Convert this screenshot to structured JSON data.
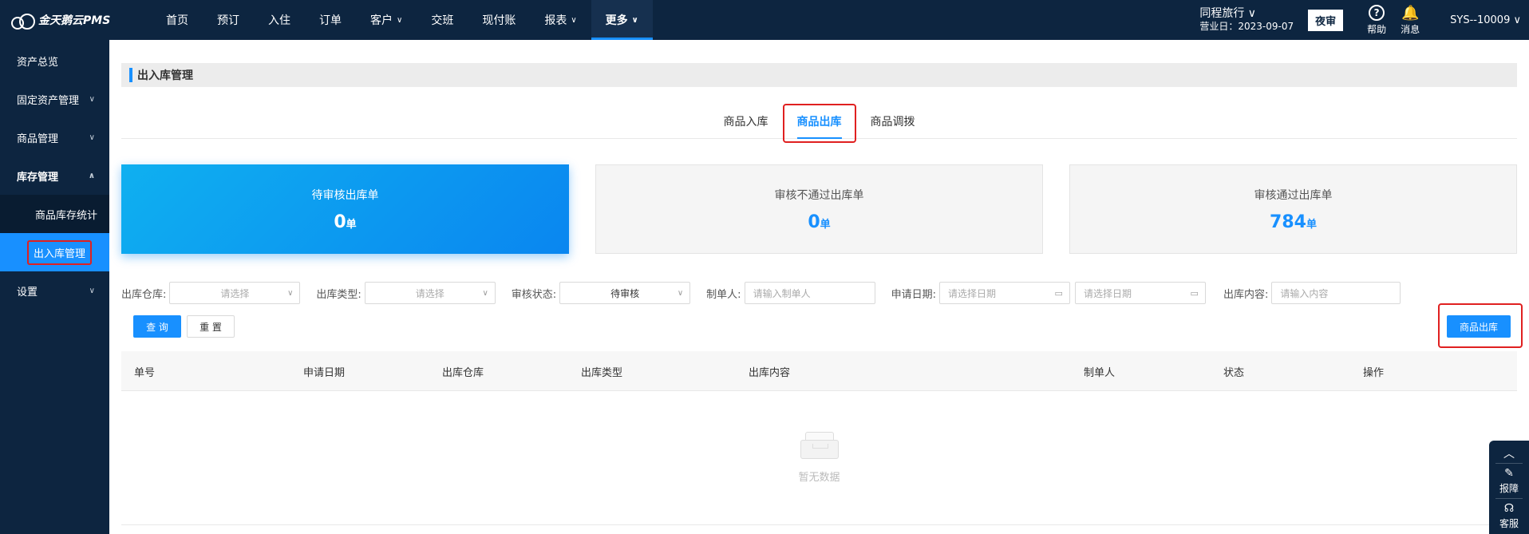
{
  "app": {
    "logo_text": "金天鹅云PMS"
  },
  "nav": [
    {
      "label": "首页",
      "chevron": ""
    },
    {
      "label": "预订",
      "chevron": ""
    },
    {
      "label": "入住",
      "chevron": ""
    },
    {
      "label": "订单",
      "chevron": ""
    },
    {
      "label": "客户",
      "chevron": "∨"
    },
    {
      "label": "交班",
      "chevron": ""
    },
    {
      "label": "现付账",
      "chevron": ""
    },
    {
      "label": "报表",
      "chevron": "∨"
    },
    {
      "label": "更多",
      "chevron": "∨"
    }
  ],
  "topright": {
    "hotel_name": "同程旅行 ∨",
    "business_date": "营业日：2023-09-07",
    "night_audit": "夜审",
    "help_icon": "?",
    "help": "帮助",
    "messages_icon": "🔔",
    "messages": "消息",
    "user": "SYS--10009 ∨"
  },
  "sidebar": {
    "items": [
      {
        "label": "资产总览",
        "arrow": ""
      },
      {
        "label": "固定资产管理",
        "arrow": "∨"
      },
      {
        "label": "商品管理",
        "arrow": "∨"
      },
      {
        "label": "库存管理",
        "arrow": "∧"
      }
    ],
    "subitems": [
      {
        "label": "商品库存统计"
      },
      {
        "label": "出入库管理"
      }
    ],
    "settings": {
      "label": "设置",
      "arrow": "∨"
    }
  },
  "page": {
    "title": "出入库管理",
    "tabs": [
      "商品入库",
      "商品出库",
      "商品调拨"
    ]
  },
  "cards": [
    {
      "title": "待审核出库单",
      "value": "0",
      "unit": "单"
    },
    {
      "title": "审核不通过出库单",
      "value": "0",
      "unit": "单"
    },
    {
      "title": "审核通过出库单",
      "value": "784",
      "unit": "单"
    }
  ],
  "filters": {
    "warehouse_label": "出库仓库:",
    "warehouse_placeholder": "请选择",
    "type_label": "出库类型:",
    "type_placeholder": "请选择",
    "status_label": "审核状态:",
    "status_value": "待审核",
    "creator_label": "制单人:",
    "creator_placeholder": "请输入制单人",
    "date_label": "申请日期:",
    "date_start_placeholder": "请选择日期",
    "date_end_placeholder": "请选择日期",
    "content_label": "出库内容:",
    "content_placeholder": "请输入内容",
    "dropdown_icon": "∨",
    "calendar_icon": "▭"
  },
  "buttons": {
    "query": "查 询",
    "reset": "重 置",
    "outbound": "商品出库"
  },
  "table": {
    "columns": [
      "单号",
      "申请日期",
      "出库仓库",
      "出库类型",
      "出库内容",
      "制单人",
      "状态",
      "操作"
    ],
    "empty_text": "暂无数据"
  },
  "float": {
    "up": "︿",
    "report_icon": "✎",
    "report": "报障",
    "service_icon": "☊",
    "service": "客服"
  }
}
